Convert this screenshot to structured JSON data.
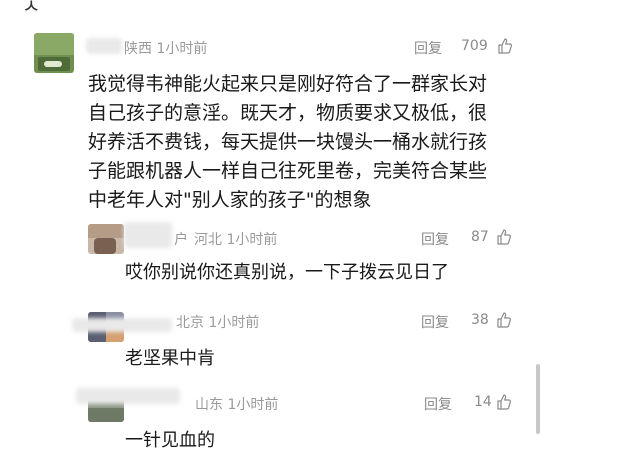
{
  "main_comment": {
    "location_time": "陕西 1小时前",
    "reply_label": "回复",
    "like_count": "709",
    "text_lines": [
      "我觉得韦神能火起来只是刚好符合了一群家长对",
      "自己孩子的意淫。既天才，物质要求又极低，很",
      "好养活不费钱，每天提供一块馒头一桶水就行孩",
      "子能跟机器人一样自己往死里卷，完美符合某些",
      "中老年人对\"别人家的孩子\"的想象"
    ]
  },
  "replies": [
    {
      "name_fragment": "户",
      "location_time": "河北 1小时前",
      "reply_label": "回复",
      "like_count": "87",
      "text": "哎你别说你还真别说，一下子拨云见日了"
    },
    {
      "name_fragment": "",
      "location_time": "北京 1小时前",
      "reply_label": "回复",
      "like_count": "38",
      "text": "老坚果中肯"
    },
    {
      "name_fragment": "",
      "location_time": "山东 1小时前",
      "reply_label": "回复",
      "like_count": "14",
      "text": "一针见血的"
    }
  ],
  "icons": {
    "like": "thumbs-up-icon"
  },
  "colors": {
    "meta_gray": "#9a9a9a",
    "text": "#1a1a1a"
  }
}
